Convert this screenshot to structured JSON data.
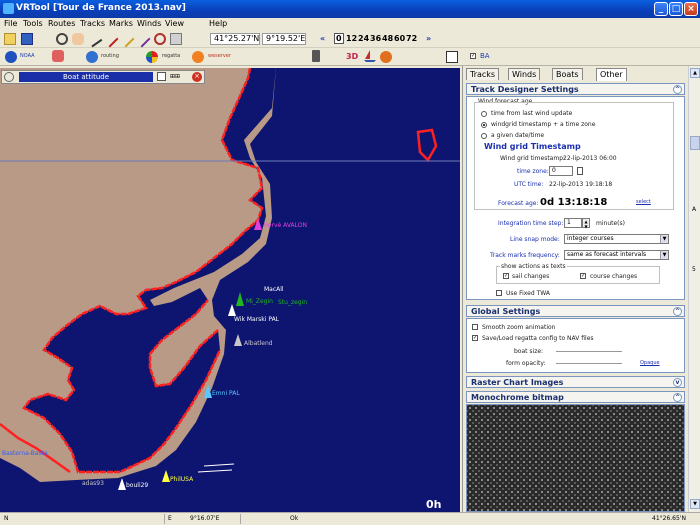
{
  "window": {
    "title": "VRTool [Tour de France 2013.nav]"
  },
  "menu": [
    "File",
    "Tools",
    "Routes",
    "Tracks",
    "Marks",
    "Winds",
    "View",
    "Help"
  ],
  "toolbar": {
    "lat": "41°25.27'N",
    "lon": "9°19.52'E",
    "hours": [
      "0",
      "12",
      "24",
      "36",
      "48",
      "60",
      "72"
    ],
    "selected_hour": "0",
    "ba_label": "BA"
  },
  "toolbar2": {
    "labels": [
      "NOAA",
      "routing",
      "regatta",
      "weserver"
    ],
    "mode_3d": "3D"
  },
  "map": {
    "boat_attitude_label": "Boat attitude",
    "hour_label": "0h",
    "boats": [
      {
        "name": "hervé AVALON",
        "color": "#e040e0"
      },
      {
        "name": "MacAll",
        "color": "#ffffff"
      },
      {
        "name": "Mi_Zegin",
        "color": "#1fb81f"
      },
      {
        "name": "Stu_zegin",
        "color": "#1fb81f"
      },
      {
        "name": "Wik Marski PAL",
        "color": "#ffffff"
      },
      {
        "name": "Albatlend",
        "color": "#c8c8c8"
      },
      {
        "name": "Emni PAL",
        "color": "#58c8ff"
      },
      {
        "name": "PhilUSA",
        "color": "#ffff40"
      },
      {
        "name": "bouli29",
        "color": "#ffffff"
      },
      {
        "name": "adas93",
        "color": "#c8c8c8"
      },
      {
        "name": "Basterna-Basta",
        "color": "#3060ff"
      }
    ]
  },
  "tabs": [
    "Tracks",
    "Winds",
    "Boats",
    "Other"
  ],
  "active_tab": "Other",
  "track_designer": {
    "title": "Track Designer Settings",
    "wind_forecast_age_label": "Wind forecast age",
    "options": [
      {
        "label": "time from last wind update",
        "selected": false
      },
      {
        "label": "windgrid timestamp + a time zone",
        "selected": true
      },
      {
        "label": "a given date/time",
        "selected": false
      }
    ],
    "wind_grid_title": "Wind grid Timestamp",
    "grid_timestamp_label": "Wind grid timestamp:",
    "grid_timestamp_value": "22-lip-2013 06:00",
    "time_zone_label": "time zone:",
    "time_zone_value": "0",
    "utc_label": "UTC time:",
    "utc_value": "22-lip-2013 19:18:18",
    "forecast_age_label": "Forecast age:",
    "forecast_age_value": "0d 13:18:18",
    "select_link": "select",
    "integration_label": "Integration time step:",
    "integration_value": "1",
    "integration_unit": "minute(s)",
    "line_snap_label": "Line snap mode:",
    "line_snap_value": "integer courses",
    "track_marks_label": "Track marks frequency:",
    "track_marks_value": "same as forecast intervals",
    "show_actions_label": "show actions as texts",
    "sail_changes_label": "sail changes",
    "course_changes_label": "course changes",
    "use_fixed_twa_label": "Use Fixed TWA"
  },
  "global_settings": {
    "title": "Global Settings",
    "smooth_zoom_label": "Smooth zoom animation",
    "save_load_label": "Save/Load regatta config to NAV files",
    "boat_size_label": "boat size:",
    "form_opacity_label": "form opacity:",
    "opaque_link": "Opaque"
  },
  "raster_chart": {
    "title": "Raster Chart Images"
  },
  "monochrome": {
    "title": "Monochrome bitmap"
  },
  "scroll_labels": {
    "a": "A",
    "five": "5"
  },
  "statusbar": {
    "left_char": "N",
    "e_char": "E",
    "lon": "9°16.07'E",
    "ok": "Ok",
    "right_lat": "41°26.65'N"
  },
  "colors": {
    "sea": "#0e1570",
    "land": "#b89a86",
    "coast": "#ff2020",
    "panel_title": "#1a2f6f"
  }
}
